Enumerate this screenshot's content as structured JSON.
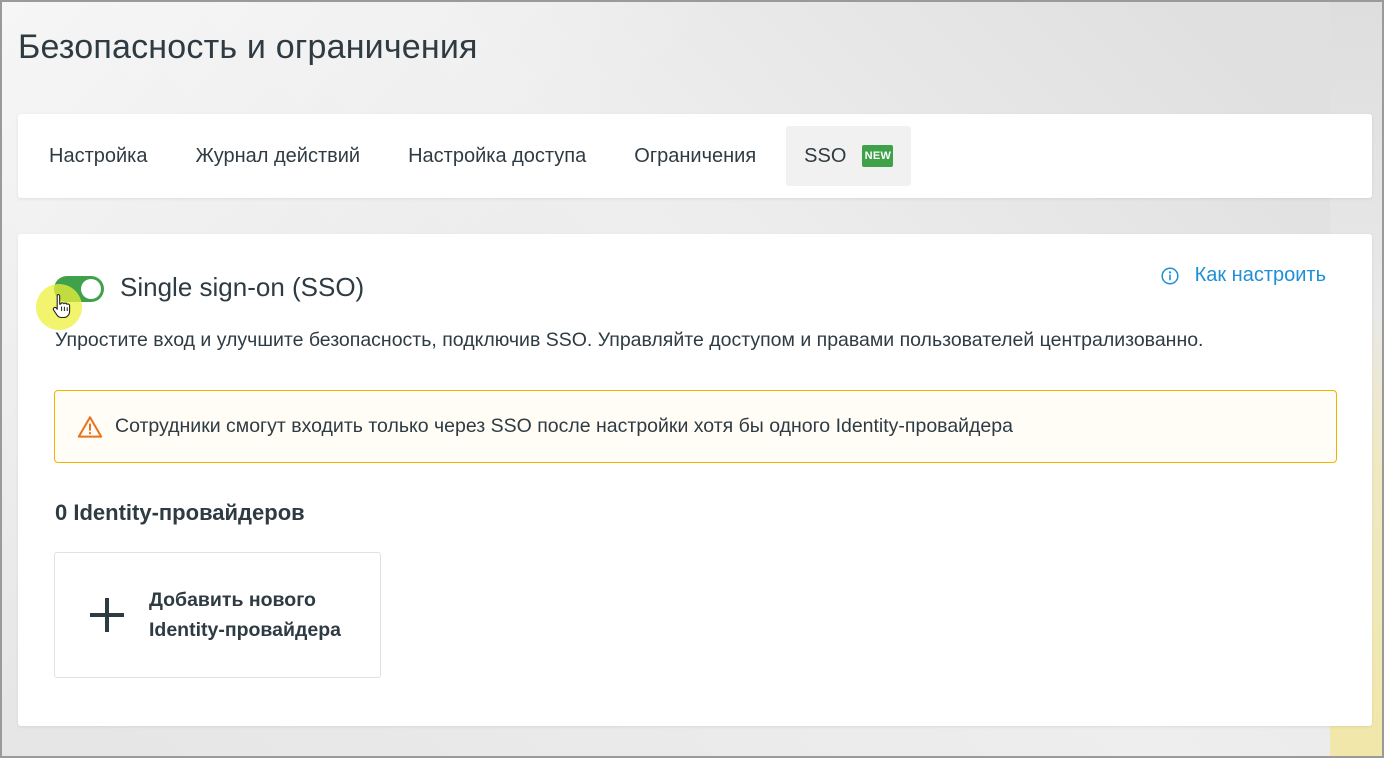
{
  "page": {
    "title": "Безопасность и ограничения"
  },
  "tabs": [
    {
      "label": "Настройка"
    },
    {
      "label": "Журнал действий"
    },
    {
      "label": "Настройка доступа"
    },
    {
      "label": "Ограничения"
    },
    {
      "label": "SSO",
      "badge": "NEW",
      "active": true
    }
  ],
  "sso": {
    "enabled": true,
    "title": "Single sign-on (SSO)",
    "help_link": "Как настроить",
    "description": "Упростите вход и улучшите безопасность, подключив SSO. Управляйте доступом и правами пользователей централизованно.",
    "warning": "Сотрудники смогут входить только через SSO после настройки хотя бы одного Identity-провайдера",
    "providers_count": "0 Identity-провайдеров",
    "add_provider_label": "Добавить нового Identity-провайдера"
  },
  "colors": {
    "accent_green": "#3fa14a",
    "link_blue": "#1f8fd6",
    "warning_orange": "#f2b200",
    "text": "#2f3b43"
  },
  "icons": [
    "info-icon",
    "warning-icon",
    "plus-icon",
    "hand-cursor-icon"
  ]
}
